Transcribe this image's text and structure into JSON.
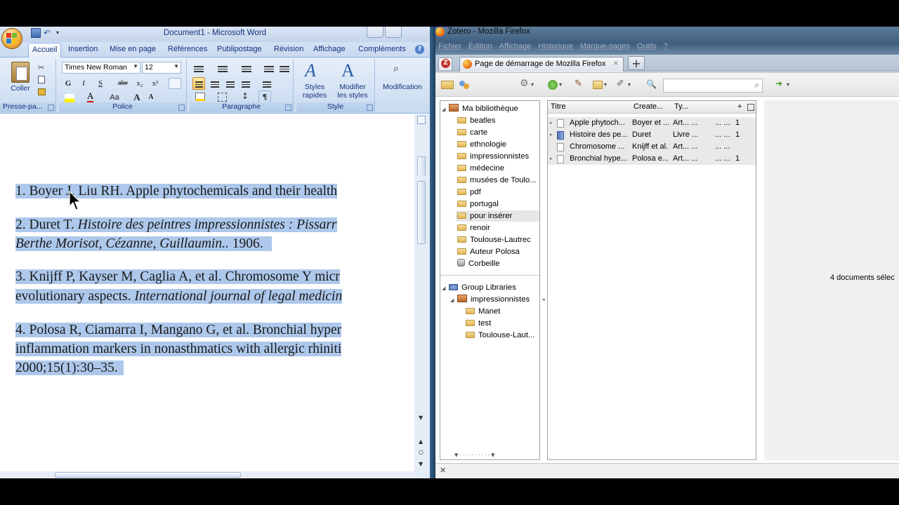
{
  "word": {
    "title": "Document1 - Microsoft Word",
    "tabs": [
      "Accueil",
      "Insertion",
      "Mise en page",
      "Références",
      "Publipostage",
      "Révision",
      "Affichage",
      "Compléments"
    ],
    "help": "?",
    "ribbon": {
      "clipboard": {
        "paste_label": "Coller",
        "group_label": "Presse-pa..."
      },
      "font": {
        "font_name": "Times New Roman",
        "font_size": "12",
        "bold": "G",
        "italic": "I",
        "underline": "S",
        "strike": "abe",
        "subscript": "x₂",
        "superscript": "x²",
        "case": "Aa",
        "grow": "A",
        "shrink": "A",
        "group_label": "Police"
      },
      "paragraph": {
        "pilcrow": "¶",
        "group_label": "Paragraphe"
      },
      "styles": {
        "quick_styles_label": "Styles\nrapides",
        "change_styles_label": "Modifier\nles styles",
        "group_label": "Style"
      },
      "editing": {
        "label": "Modification"
      }
    },
    "document": {
      "references": [
        {
          "lines": [
            {
              "text": "1. Boyer J, Liu RH. Apple phytochemicals and their health",
              "italic": ""
            }
          ]
        },
        {
          "lines": [
            {
              "text": "2. Duret T. ",
              "italic": "Histoire des peintres impressionnistes : Pissarr"
            },
            {
              "text": "",
              "italic": "Berthe Morisot, Cézanne, Guillaumin..",
              "after": " 1906."
            }
          ]
        },
        {
          "lines": [
            {
              "text": "3. Knijff P, Kayser M, Caglia A, et al. Chromosome Y micr",
              "italic": ""
            },
            {
              "text": "evolutionary aspects. ",
              "italic": "International journal of legal medicin"
            }
          ]
        },
        {
          "lines": [
            {
              "text": "4. Polosa R, Ciamarra I, Mangano G, et al. Bronchial hyper",
              "italic": ""
            },
            {
              "text": "inflammation markers in nonasthmatics with allergic rhiniti",
              "italic": ""
            },
            {
              "text": "2000;15(1):30–35.",
              "italic": ""
            }
          ]
        }
      ]
    }
  },
  "firefox": {
    "title": "Zotero - Mozilla Firefox",
    "menu": [
      "Fichier",
      "Édition",
      "Affichage",
      "Historique",
      "Marque-pages",
      "Outils",
      "?"
    ],
    "tab_label": "Page de démarrage de Mozilla Firefox",
    "zotero_tab_letter": "Z",
    "new_tab": "+",
    "close_tab": "×"
  },
  "zotero": {
    "my_library": "Ma bibliothèque",
    "collections": [
      "beatles",
      "carte",
      "ethnologie",
      "impressionnistes",
      "médecine",
      "musées de Toulo...",
      "pdf",
      "portugal",
      "pour insérer",
      "renoir",
      "Toulouse-Lautrec"
    ],
    "highlighted_collection": "pour insérer",
    "author_saved_search": "Auteur Polosa",
    "trash": "Corbeille",
    "group_libraries": "Group Libraries",
    "group": "impressionnistes",
    "group_collections": [
      "Manet",
      "test",
      "Toulouse-Laut..."
    ],
    "columns": {
      "title": "Titre",
      "creator": "Create...",
      "type": "Ty...",
      "add": "+"
    },
    "items": [
      {
        "title": "Apple phytoch...",
        "creator": "Boyer et ...",
        "type": "Art... ...",
        "extra": "... ...",
        "count": "1",
        "icon": "doc"
      },
      {
        "title": "Histoire des pe...",
        "creator": "Duret",
        "type": "Livre ...",
        "extra": "... ...",
        "count": "1",
        "icon": "book"
      },
      {
        "title": "Chromosome ...",
        "creator": "Knijff et al.",
        "type": "Art... ...",
        "extra": "... ...",
        "count": "",
        "icon": "doc"
      },
      {
        "title": "Bronchial hype...",
        "creator": "Polosa e...",
        "type": "Art... ...",
        "extra": "... ...",
        "count": "1",
        "icon": "doc"
      }
    ],
    "status": "4 documents sélec"
  },
  "colors": {
    "selection": "#adc8eb",
    "word_tab_text": "#15317e",
    "zotero_tab": "#c3342e"
  }
}
